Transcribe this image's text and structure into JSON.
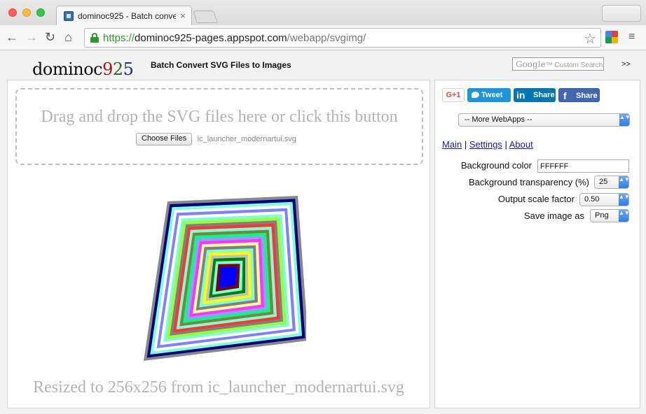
{
  "browser": {
    "tab_title": "dominoc925 - Batch conve",
    "tab_close": "×",
    "url_scheme": "https://",
    "url_host": "dominoc925-pages.appspot.com",
    "url_path": "/webapp/svgimg/",
    "nav": {
      "back": "←",
      "forward": "→",
      "reload": "↻",
      "home": "⌂",
      "star": "☆",
      "menu": "≡"
    }
  },
  "header": {
    "logo_text": "dominoc",
    "logo_digits": [
      "9",
      "2",
      "5"
    ],
    "title": "Batch Convert SVG Files to Images",
    "search_brand": "Google",
    "search_label": "™ Custom Search",
    "expand": ">>"
  },
  "dropzone": {
    "prompt": "Drag and drop the SVG files here or click this button",
    "choose_label": "Choose Files",
    "file_name": "ic_launcher_modernartui.svg"
  },
  "preview": {
    "caption": "Resized to 256x256 from ic_launcher_modernartui.svg",
    "ring_colors": [
      "#888888",
      "#000080",
      "#7fffd4",
      "#ffffff",
      "#8080ff",
      "#ffffff",
      "#7fffd4",
      "#99ff33",
      "#808080",
      "#ff3333",
      "#7fffd4",
      "#808040",
      "#00ff7f",
      "#9999ff",
      "#ff33ff",
      "#ffff99",
      "#808080",
      "#7fffd4",
      "#ffff00",
      "#c0c0c0",
      "#008000",
      "#7fffd4",
      "#800000",
      "#0000ff"
    ]
  },
  "sidebar": {
    "share": {
      "gplus": "G+1",
      "tweet": "Tweet",
      "linkedin_logo": "in",
      "linkedin": "Share",
      "facebook_logo": "f",
      "facebook": "Share"
    },
    "webapps_select": "-- More WebApps --",
    "links": {
      "main": "Main",
      "settings": "Settings",
      "about": "About",
      "sep": "|"
    },
    "settings": {
      "background_color_label": "Background color",
      "background_color_value": "FFFFFF",
      "transparency_label": "Background transparency (%)",
      "transparency_value": "25",
      "scale_label": "Output scale factor",
      "scale_value": "0.50",
      "save_label": "Save image as",
      "save_value": "Png"
    },
    "chevron": "▲▼"
  }
}
